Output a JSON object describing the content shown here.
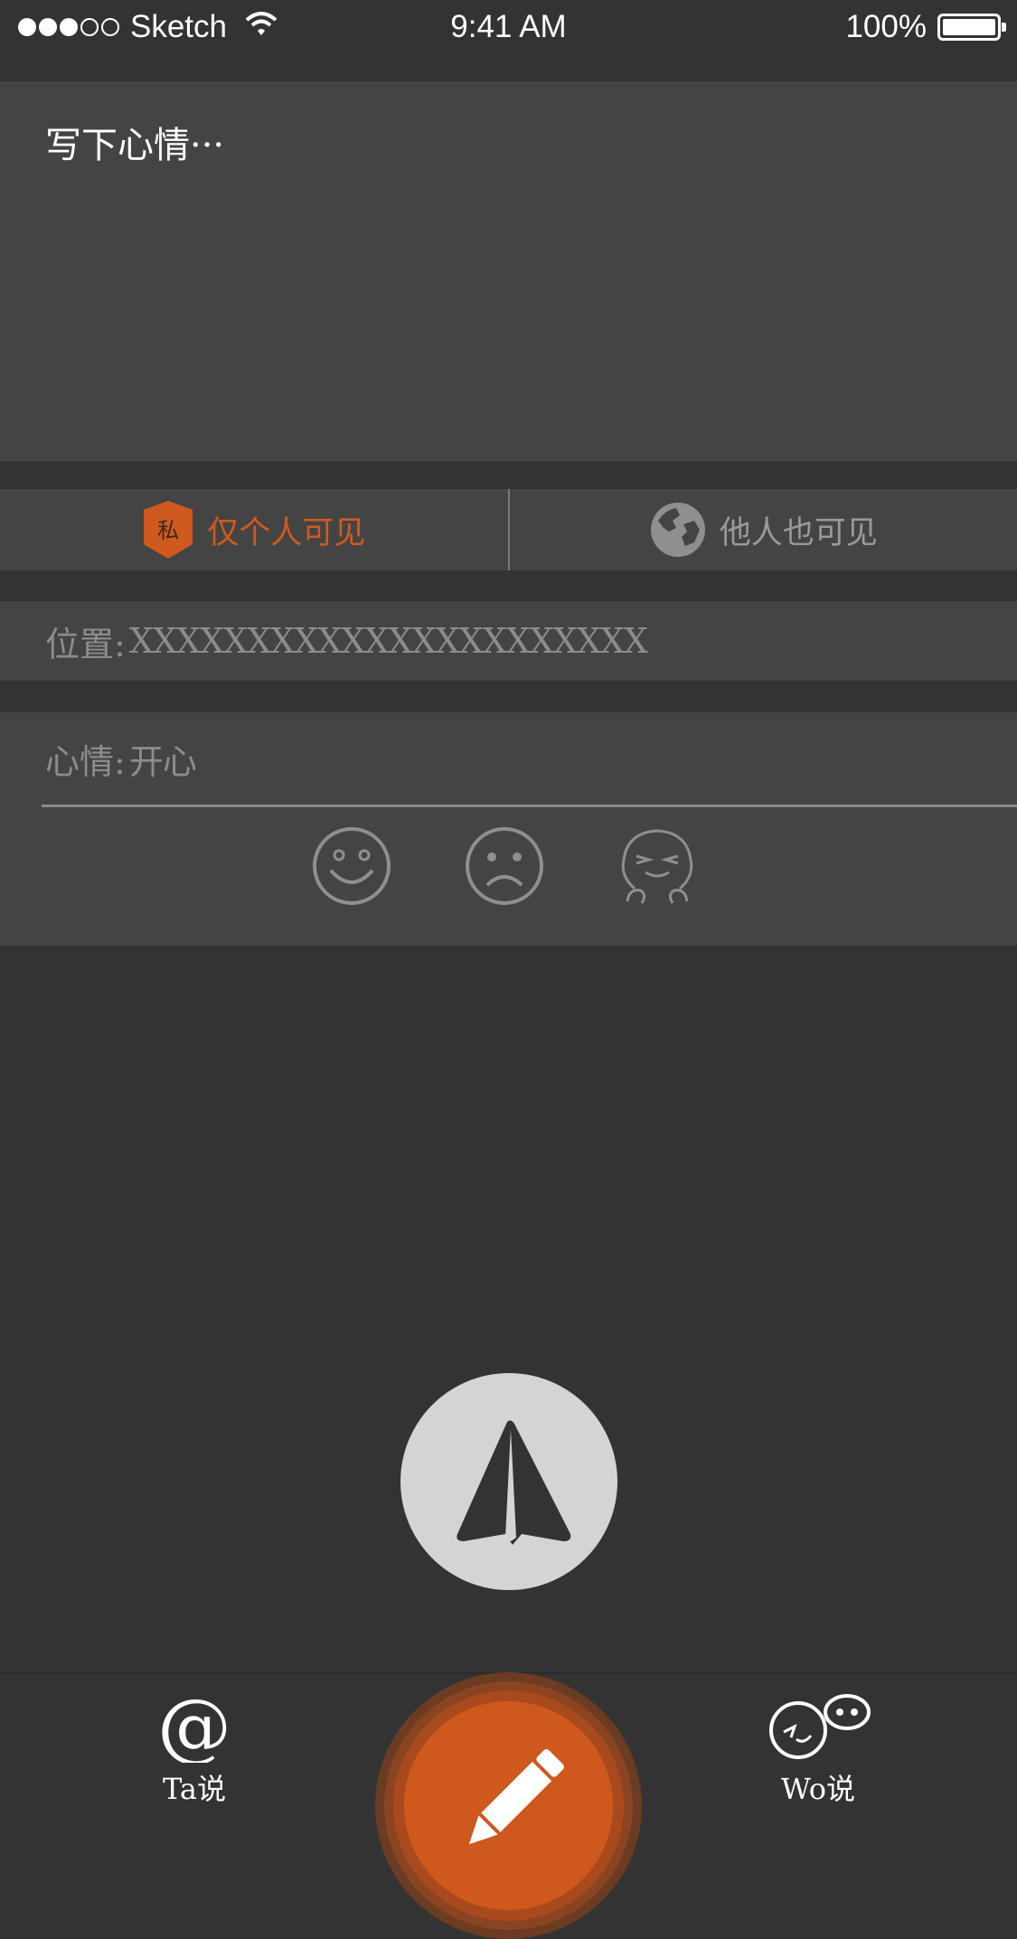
{
  "status_bar": {
    "carrier": "Sketch",
    "time": "9:41 AM",
    "battery": "100%",
    "signal_bars_full": 3,
    "signal_bars_total": 5
  },
  "editor": {
    "placeholder": "写下心情···"
  },
  "visibility": {
    "private_label": "仅个人可见",
    "private_badge": "私",
    "public_label": "他人也可见",
    "selected": "private"
  },
  "location": {
    "label": "位置:",
    "value": "XXXXXXXXXXXXXXXXXXXXXX"
  },
  "mood": {
    "label": "心情:",
    "value": "开心",
    "options": [
      "smile-icon",
      "sad-icon",
      "shy-icon"
    ]
  },
  "send": {
    "icon": "paper-plane-icon"
  },
  "tabbar": {
    "ta_label": "Ta说",
    "wo_label": "Wo说",
    "compose_icon": "pencil-icon"
  },
  "colors": {
    "background": "#333333",
    "panel": "#444444",
    "accent": "#d05a1e",
    "muted_text": "#8c8c8c"
  }
}
